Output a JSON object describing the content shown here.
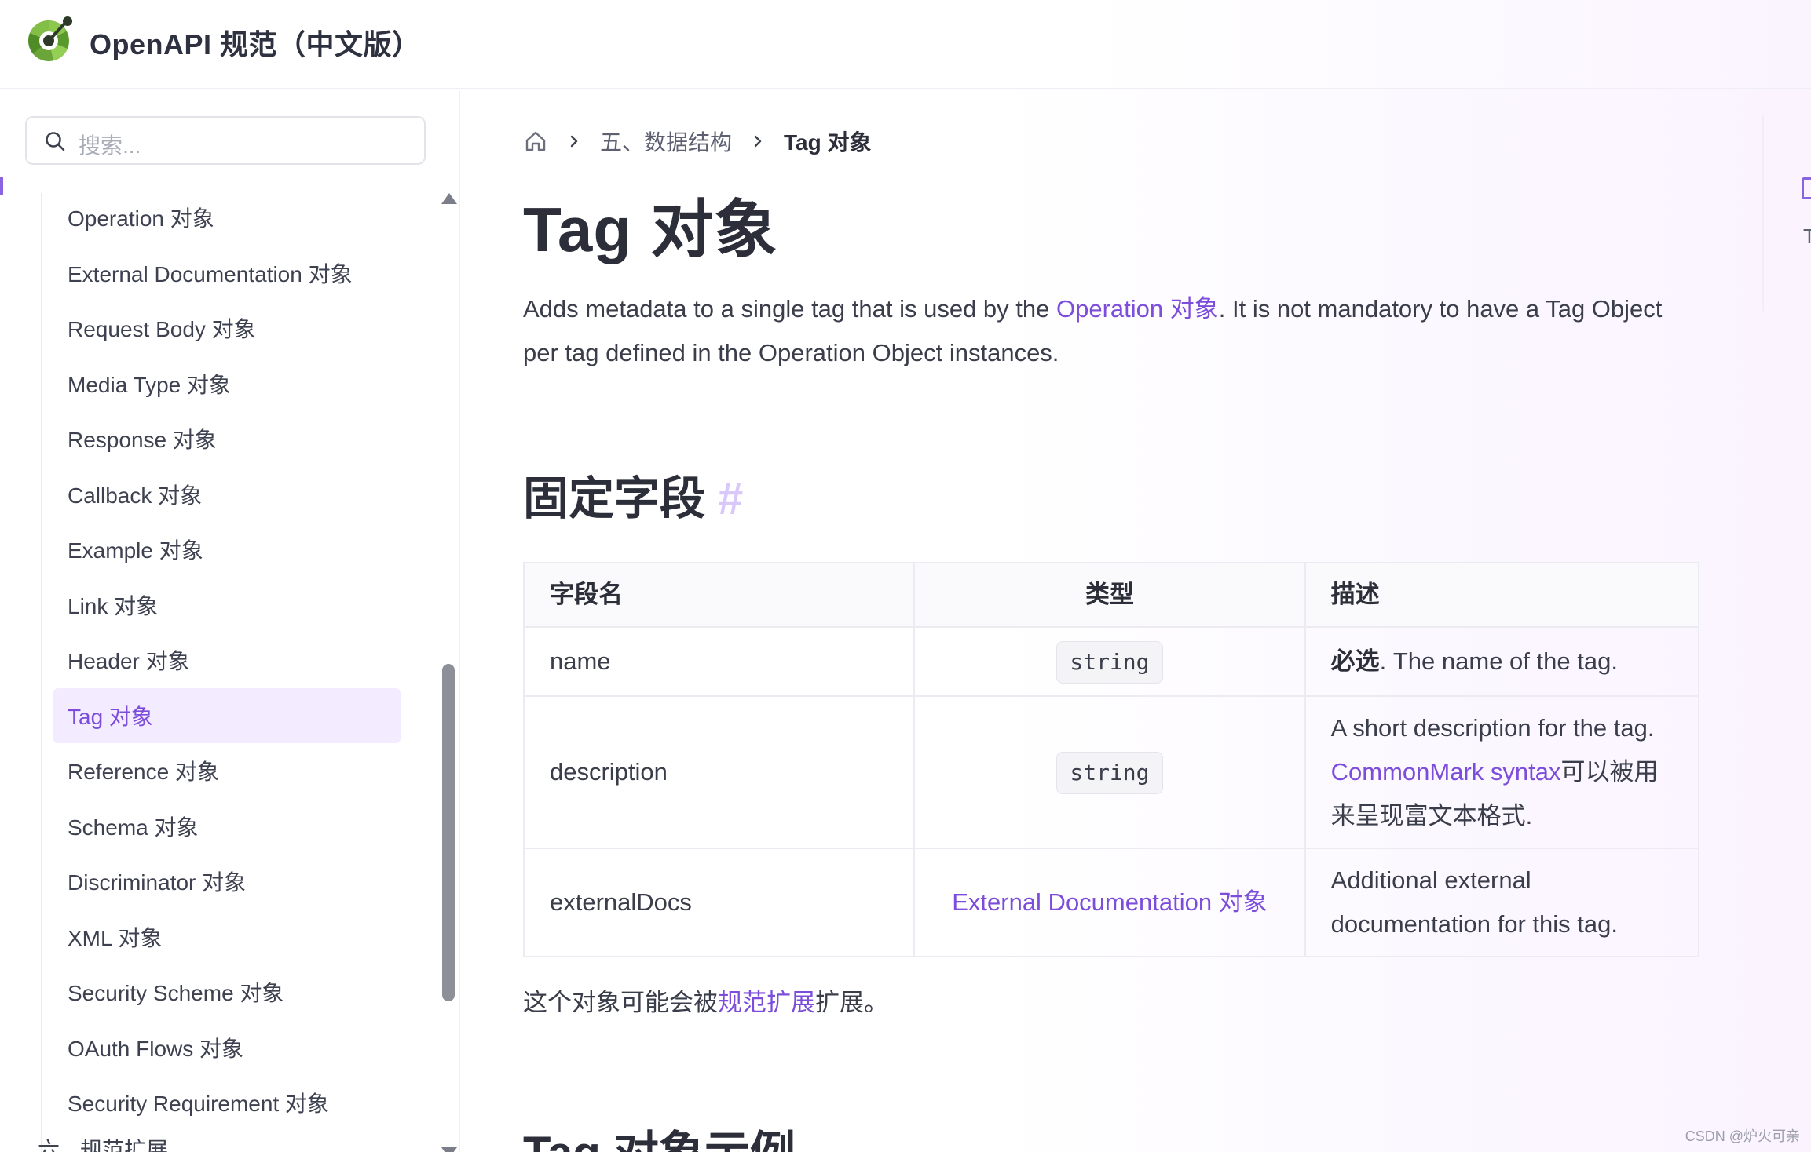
{
  "site": {
    "title": "OpenAPI 规范（中文版）",
    "brand_color": "#7c4ddb"
  },
  "search": {
    "placeholder": "搜索...",
    "icon": "search-icon"
  },
  "sidebar": {
    "items": [
      {
        "label": "Operation 对象",
        "active": false
      },
      {
        "label": "External Documentation 对象",
        "active": false
      },
      {
        "label": "Request Body 对象",
        "active": false
      },
      {
        "label": "Media Type 对象",
        "active": false
      },
      {
        "label": "Response 对象",
        "active": false
      },
      {
        "label": "Callback 对象",
        "active": false
      },
      {
        "label": "Example 对象",
        "active": false
      },
      {
        "label": "Link 对象",
        "active": false
      },
      {
        "label": "Header 对象",
        "active": false
      },
      {
        "label": "Tag 对象",
        "active": true
      },
      {
        "label": "Reference 对象",
        "active": false
      },
      {
        "label": "Schema 对象",
        "active": false
      },
      {
        "label": "Discriminator 对象",
        "active": false
      },
      {
        "label": "XML 对象",
        "active": false
      },
      {
        "label": "Security Scheme 对象",
        "active": false
      },
      {
        "label": "OAuth Flows 对象",
        "active": false
      },
      {
        "label": "Security Requirement 对象",
        "active": false
      }
    ],
    "next_section": {
      "number": "六",
      "label": "规范扩展"
    }
  },
  "breadcrumb": {
    "home_icon": "home-icon",
    "section": "五、数据结构",
    "current": "Tag 对象"
  },
  "content": {
    "title": "Tag 对象",
    "intro_before": "Adds metadata to a single tag that is used by the ",
    "intro_link": "Operation 对象",
    "intro_after": ". It is not mandatory to have a Tag Object per tag defined in the Operation Object instances.",
    "fixed_fields_heading": "固定字段",
    "anchor_symbol": "#",
    "table": {
      "headers": [
        "字段名",
        "类型",
        "描述"
      ],
      "rows": [
        {
          "field": "name",
          "type": "string",
          "desc_strong": "必选",
          "desc": ". The name of the tag."
        },
        {
          "field": "description",
          "type": "string",
          "desc": "A short description for the tag.",
          "desc_link": "CommonMark syntax",
          "desc_after": "可以被用来呈现富文本格式."
        },
        {
          "field": "externalDocs",
          "type_link": "External Documentation 对象",
          "desc": "Additional external documentation for this tag."
        }
      ]
    },
    "extension_before": "这个对象可能会被",
    "extension_link": "规范扩展",
    "extension_after": "扩展。",
    "example_heading": "Tag 对象示例"
  },
  "outline": {
    "text": "T"
  },
  "watermark": "CSDN @炉火可亲"
}
